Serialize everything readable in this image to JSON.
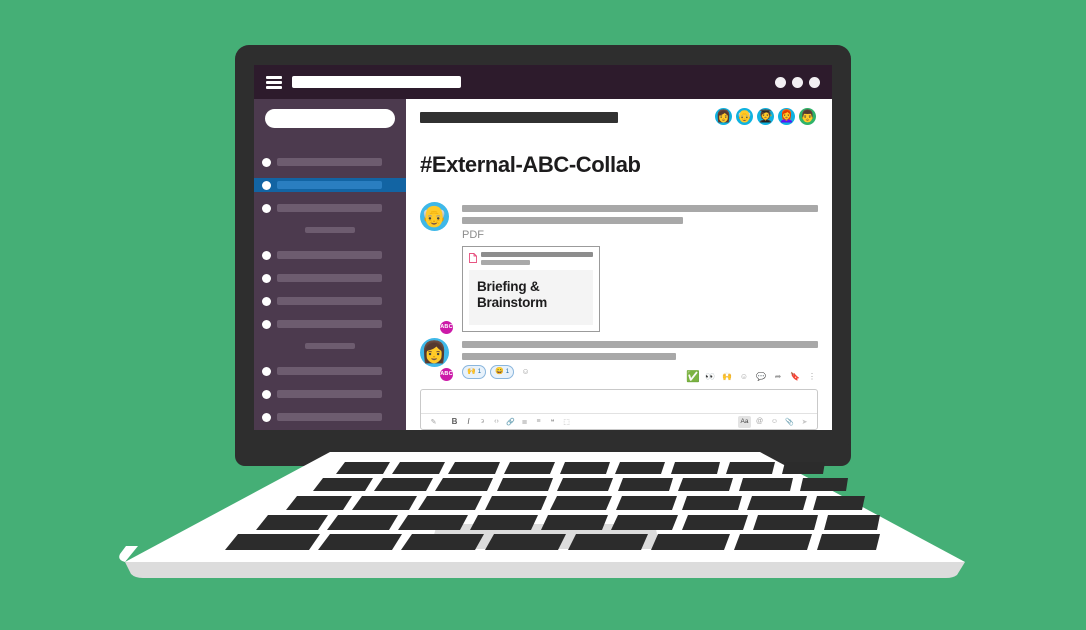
{
  "scene": {
    "background_color": "#45af76",
    "device": "laptop-illustration"
  },
  "app": {
    "topbar": {
      "menu_icon": "hamburger-icon",
      "search_placeholder": "",
      "search_value": "",
      "window_controls": [
        "dot",
        "dot",
        "dot"
      ]
    },
    "sidebar": {
      "background_color": "#4c3a4e",
      "selected_color": "#1264a3",
      "workspace_pill": "",
      "items": [
        {
          "label": "",
          "selected": false
        },
        {
          "label": "",
          "selected": true
        },
        {
          "label": "",
          "selected": false
        },
        {
          "divider": true
        },
        {
          "label": "",
          "selected": false
        },
        {
          "label": "",
          "selected": false
        },
        {
          "label": "",
          "selected": false
        },
        {
          "label": "",
          "selected": false
        },
        {
          "divider": true
        },
        {
          "label": "",
          "selected": false
        },
        {
          "label": "",
          "selected": false
        },
        {
          "label": "",
          "selected": false
        }
      ]
    },
    "channel": {
      "header_bar": "",
      "title": "#External-ABC-Collab",
      "members": [
        {
          "name": "member-1",
          "emoji": "👩",
          "bg": "#0fb2e0"
        },
        {
          "name": "member-2",
          "emoji": "👴",
          "bg": "#0fb2e0"
        },
        {
          "name": "member-3",
          "emoji": "🧑‍🎓",
          "bg": "#0fb2e0"
        },
        {
          "name": "member-4",
          "emoji": "👩‍🦰",
          "bg": "#0fb2e0"
        },
        {
          "name": "member-5",
          "emoji": "👨",
          "bg": "#2fb36a"
        }
      ]
    },
    "messages": [
      {
        "id": "message-1",
        "author_badge": "ABC",
        "author_emoji": "👴",
        "author_bg": "#3fb8e8",
        "text_lines": [
          100,
          62
        ],
        "attachment": {
          "type_label": "PDF",
          "file_icon": "pdf-file-icon",
          "filename_bar": "",
          "meta_bar": "",
          "preview_title": "Briefing & Brainstorm"
        }
      },
      {
        "id": "message-2",
        "author_badge": "ABC",
        "author_emoji": "👩",
        "author_bg": "#3fb8e8",
        "text_lines": [
          100,
          60
        ],
        "reactions": [
          {
            "name": "raising-hands-reaction",
            "emoji": "🙌",
            "count": "1"
          },
          {
            "name": "smile-reaction",
            "emoji": "😄",
            "count": "1"
          }
        ],
        "add_reaction_icon": "add-reaction-icon"
      }
    ],
    "hover_actions": [
      {
        "name": "white-check-mark-reaction",
        "glyph": "✅"
      },
      {
        "name": "eyes-reaction",
        "glyph": "👀"
      },
      {
        "name": "raising-hands-reaction",
        "glyph": "🙌"
      },
      {
        "name": "add-reaction-icon",
        "glyph": "☺"
      },
      {
        "name": "reply-in-thread-icon",
        "glyph": "⬜"
      },
      {
        "name": "share-message-icon",
        "glyph": "➦"
      },
      {
        "name": "save-message-icon",
        "glyph": "☐"
      },
      {
        "name": "more-actions-icon",
        "glyph": "⋮"
      }
    ],
    "composer": {
      "value": "",
      "placeholder": "",
      "toolbar_left": [
        {
          "name": "formatting-icon",
          "glyph": "✐"
        },
        {
          "name": "bold-button",
          "glyph": "B"
        },
        {
          "name": "italic-button",
          "glyph": "I"
        },
        {
          "name": "strikethrough-button",
          "glyph": "S"
        },
        {
          "name": "code-button",
          "glyph": "‹›"
        },
        {
          "name": "link-button",
          "glyph": "🔗"
        },
        {
          "name": "ordered-list-button",
          "glyph": "≣"
        },
        {
          "name": "bulleted-list-button",
          "glyph": "≡"
        },
        {
          "name": "blockquote-button",
          "glyph": "❝"
        },
        {
          "name": "code-block-button",
          "glyph": "⬚"
        }
      ],
      "toolbar_right": [
        {
          "name": "text-formatting-toggle",
          "glyph": "Aa"
        },
        {
          "name": "mention-button",
          "glyph": "@"
        },
        {
          "name": "emoji-button",
          "glyph": "☺"
        },
        {
          "name": "attach-file-button",
          "glyph": "📎"
        },
        {
          "name": "send-button",
          "glyph": "➤"
        }
      ]
    }
  }
}
